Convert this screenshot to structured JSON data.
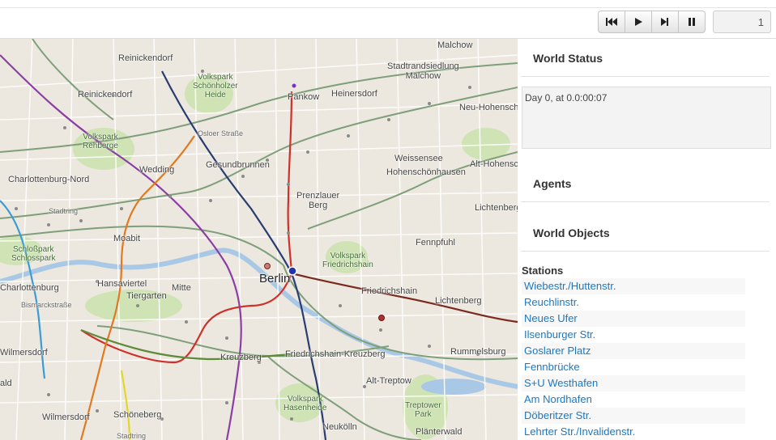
{
  "toolbar": {
    "buttons": [
      {
        "name": "rewind-button",
        "icon": "skip-back-icon"
      },
      {
        "name": "play-button",
        "icon": "play-icon"
      },
      {
        "name": "step-button",
        "icon": "step-forward-icon"
      },
      {
        "name": "pause-button",
        "icon": "pause-icon"
      }
    ],
    "step_value": "1"
  },
  "map": {
    "labels": {
      "malchow": "Malchow",
      "reinickendorf": "Reinickendorf",
      "reinickendorf2": "Reinickendorf",
      "volkspark_schoenholzer": "Volkspark\nSchönholzer\nHeide",
      "stadtrand": "Stadtrandsiedlung\nMalchow",
      "pankow": "Pankow",
      "heinersdorf": "Heinersdorf",
      "neu_hohenschoen": "Neu-Hohenschö",
      "volkspark_rehberge": "Volkspark\nRehberge",
      "osloer": "Osloer Straße",
      "weissensee": "Weissensee",
      "hohenschoenhausen": "Hohenschönhausen",
      "alt_hohen": "Alt-Hohensch",
      "wedding": "Wedding",
      "gesundbrunnen": "Gesundbrunnen",
      "charlottenburg_nord": "Charlottenburg-Nord",
      "prenzlauer": "Prenzlauer\nBerg",
      "lichtenberg_top": "Lichtenberg",
      "stadtring": "Stadtring",
      "fennpfuhl": "Fennpfuhl",
      "moabit": "Moabit",
      "schlosspark": "Schloßpark\nSchlosspark",
      "volkspark_fhain": "Volkspark\nFriedrichshain",
      "berlin": "Berlin",
      "hansaviertel": "Hansaviertel",
      "mitte": "Mitte",
      "charlottenburg": "Charlottenburg",
      "tiergarten": "Tiergarten",
      "friedrichshain": "Friedrichshain",
      "lichtenberg": "Lichtenberg",
      "bismarck": "Bismarckstraße",
      "wilmersdorf1": "Wilmersdorf",
      "kreuzberg": "Kreuzberg",
      "fhain_kreuzberg": "Friedrichshain-Kreuzberg",
      "rummelsburg": "Rummelsburg",
      "alt_treptow": "Alt-Treptow",
      "wald": "ald",
      "volkspark_hasenheide": "Volkspark\nHasenheide",
      "treptower_park": "Treptower\nPark",
      "wilmersdorf2": "Wilmersdorf",
      "schoeneberg": "Schöneberg",
      "plaenterwald": "Plänterwald",
      "neukoelln": "Neukölln",
      "stadtring2": "Stadtring",
      "aldt": "ald"
    }
  },
  "sidebar": {
    "world_status": {
      "title": "World Status",
      "text": "Day 0, at 0.0:00:07"
    },
    "agents": {
      "title": "Agents"
    },
    "world_objects": {
      "title": "World Objects"
    },
    "stations": {
      "title": "Stations",
      "items": [
        "Wiebestr./Huttenstr.",
        "Reuchlinstr.",
        "Neues Ufer",
        "Ilsenburger Str.",
        "Goslarer Platz",
        "Fennbrücke",
        "S+U Westhafen",
        "Am Nordhafen",
        "Döberitzer Str.",
        "Lehrter Str./Invalidenstr."
      ]
    }
  }
}
